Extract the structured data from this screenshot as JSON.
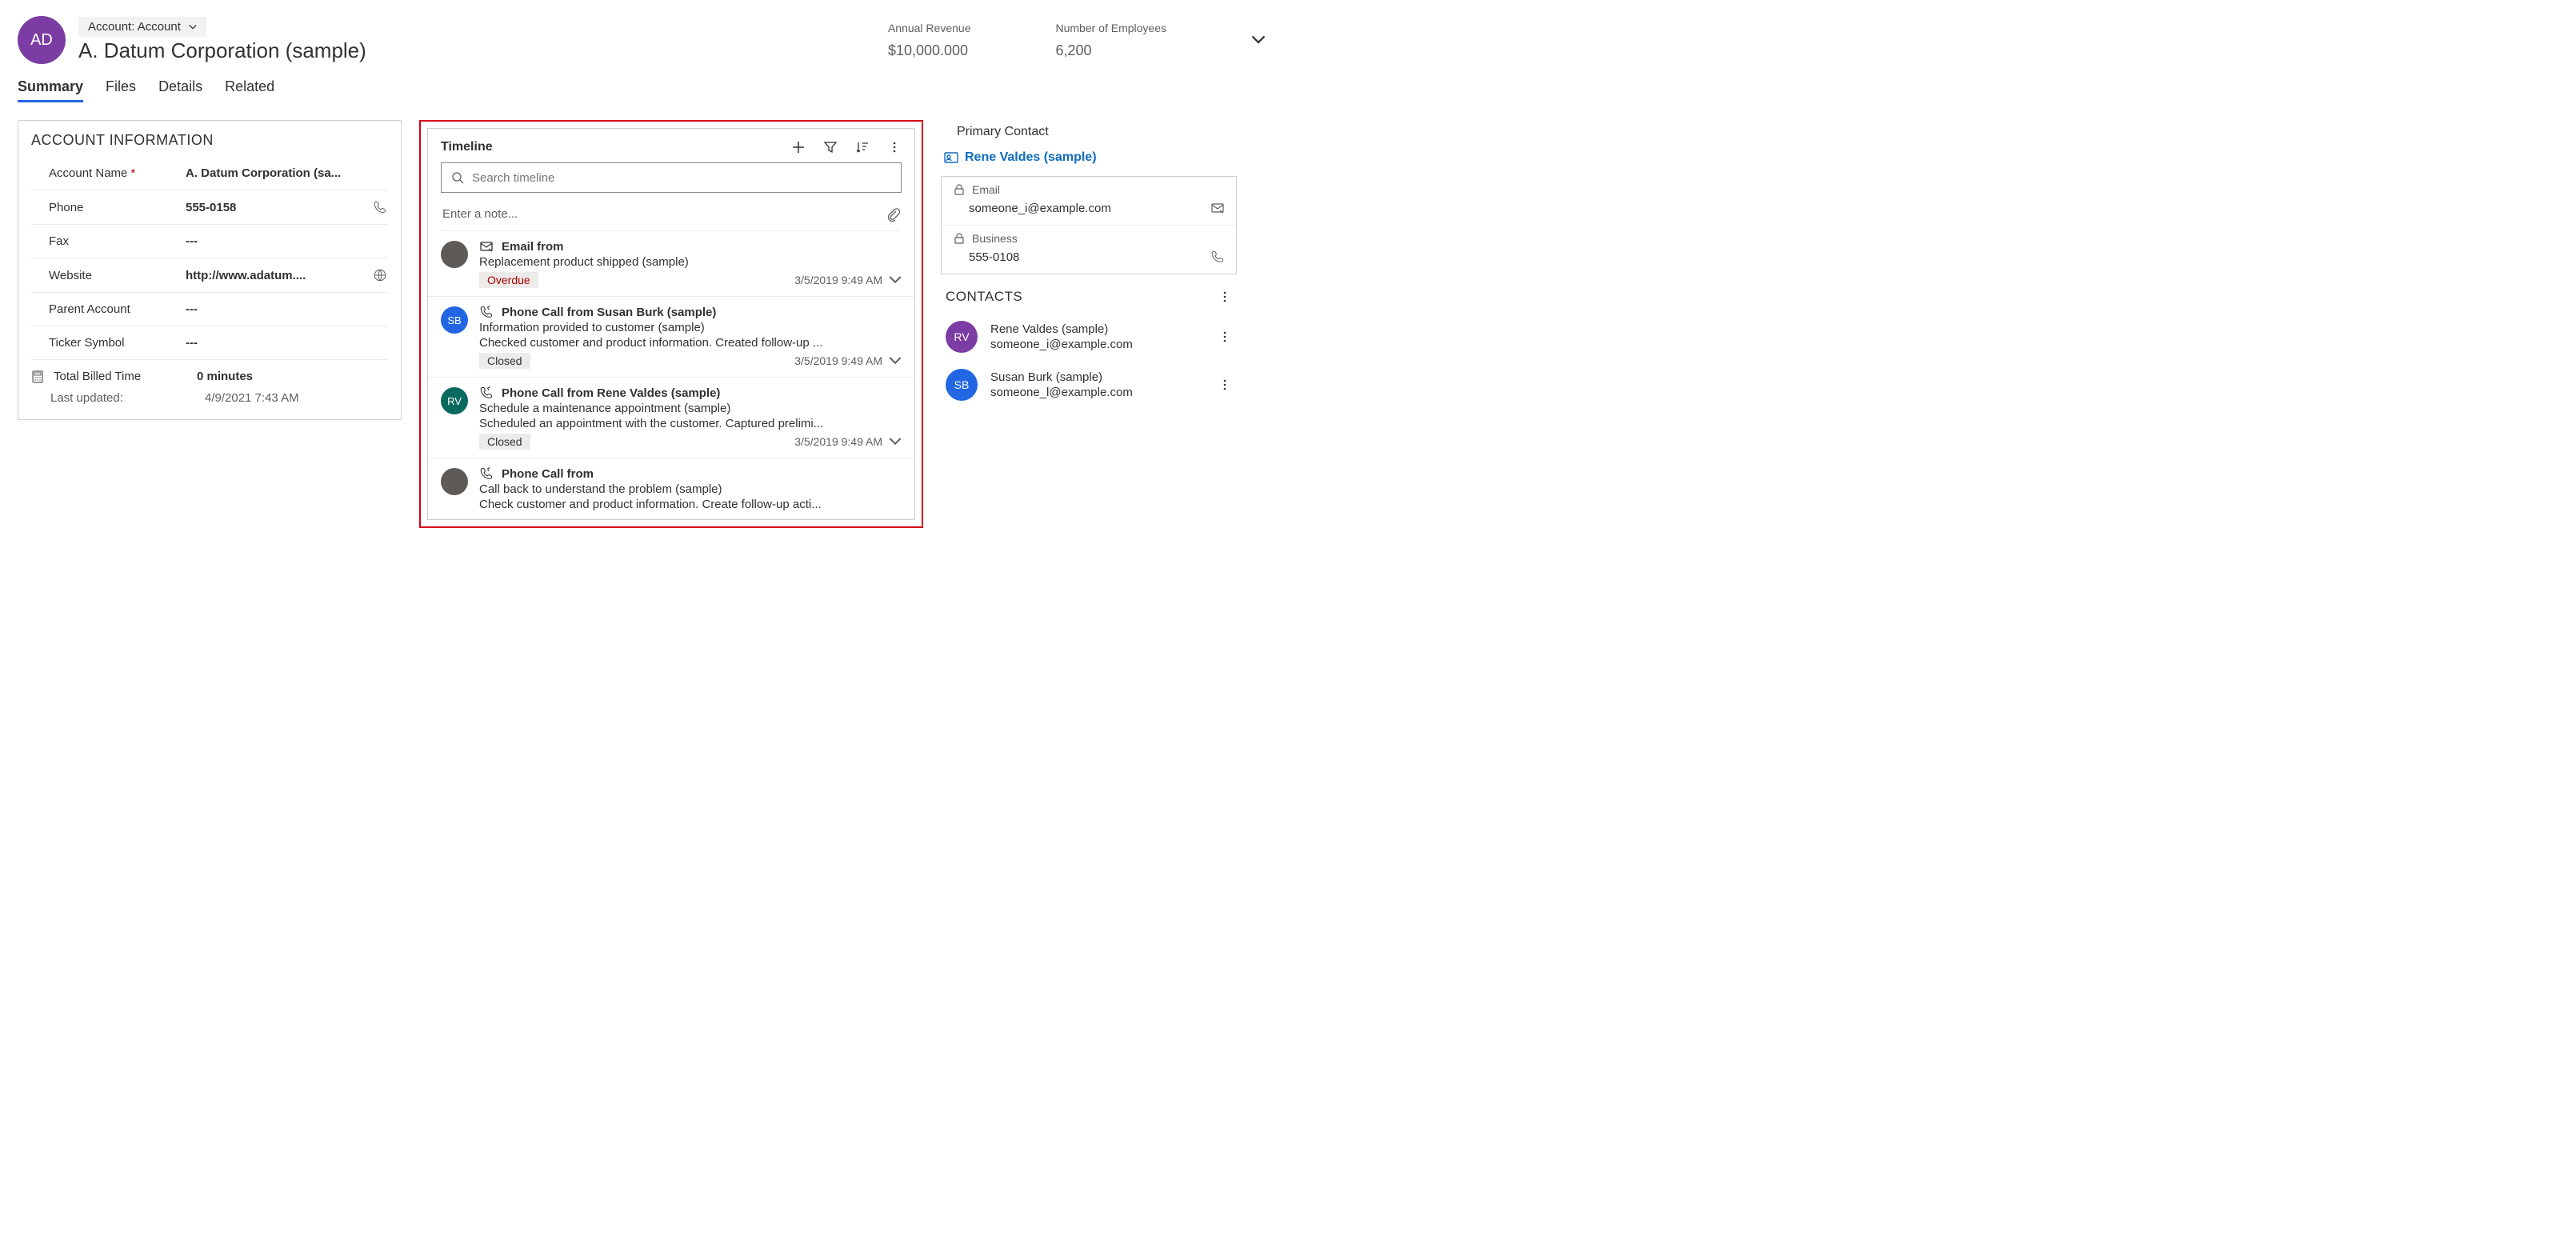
{
  "header": {
    "avatar_initials": "AD",
    "breadcrumb": "Account: Account",
    "title": "A. Datum Corporation (sample)",
    "stats": [
      {
        "label": "Annual Revenue",
        "value": "$10,000.000"
      },
      {
        "label": "Number of Employees",
        "value": "6,200"
      }
    ]
  },
  "tabs": [
    "Summary",
    "Files",
    "Details",
    "Related"
  ],
  "active_tab": "Summary",
  "account_info": {
    "section_title": "ACCOUNT INFORMATION",
    "fields": {
      "account_name": {
        "label": "Account Name",
        "value": "A. Datum Corporation (sa...",
        "required": true
      },
      "phone": {
        "label": "Phone",
        "value": "555-0158"
      },
      "fax": {
        "label": "Fax",
        "value": "---"
      },
      "website": {
        "label": "Website",
        "value": "http://www.adatum...."
      },
      "parent": {
        "label": "Parent Account",
        "value": "---"
      },
      "ticker": {
        "label": "Ticker Symbol",
        "value": "---"
      }
    },
    "billed": {
      "label": "Total Billed Time",
      "value": "0 minutes"
    },
    "updated": {
      "label": "Last updated:",
      "value": "4/9/2021 7:43 AM"
    }
  },
  "timeline": {
    "title": "Timeline",
    "search_placeholder": "Search timeline",
    "note_placeholder": "Enter a note...",
    "items": [
      {
        "avatar": "",
        "avatar_color": "#5d5a58",
        "icon": "email",
        "title": "Email from",
        "subject": "Replacement product shipped (sample)",
        "preview": "",
        "badge": "Overdue",
        "badge_kind": "overdue",
        "time": "3/5/2019 9:49 AM"
      },
      {
        "avatar": "SB",
        "avatar_color": "#2266e3",
        "icon": "phone",
        "title": "Phone Call from Susan Burk (sample)",
        "subject": "Information provided to customer (sample)",
        "preview": "Checked customer and product information. Created follow-up ...",
        "badge": "Closed",
        "badge_kind": "closed",
        "time": "3/5/2019 9:49 AM"
      },
      {
        "avatar": "RV",
        "avatar_color": "#0b6a5f",
        "icon": "phone",
        "title": "Phone Call from Rene Valdes (sample)",
        "subject": "Schedule a maintenance appointment (sample)",
        "preview": "Scheduled an appointment with the customer. Captured prelimi...",
        "badge": "Closed",
        "badge_kind": "closed",
        "time": "3/5/2019 9:49 AM"
      },
      {
        "avatar": "",
        "avatar_color": "#5d5a58",
        "icon": "phone",
        "title": "Phone Call from",
        "subject": "Call back to understand the problem (sample)",
        "preview": "Check customer and product information. Create follow-up acti...",
        "badge": "",
        "badge_kind": "",
        "time": ""
      }
    ]
  },
  "primary_contact": {
    "section_title": "Primary Contact",
    "link": "Rene Valdes (sample)",
    "email": {
      "label": "Email",
      "value": "someone_i@example.com"
    },
    "business": {
      "label": "Business",
      "value": "555-0108"
    }
  },
  "contacts": {
    "section_title": "CONTACTS",
    "items": [
      {
        "initials": "RV",
        "color": "#7b3ca3",
        "name": "Rene Valdes (sample)",
        "email": "someone_i@example.com"
      },
      {
        "initials": "SB",
        "color": "#2266e3",
        "name": "Susan Burk (sample)",
        "email": "someone_l@example.com"
      }
    ]
  }
}
